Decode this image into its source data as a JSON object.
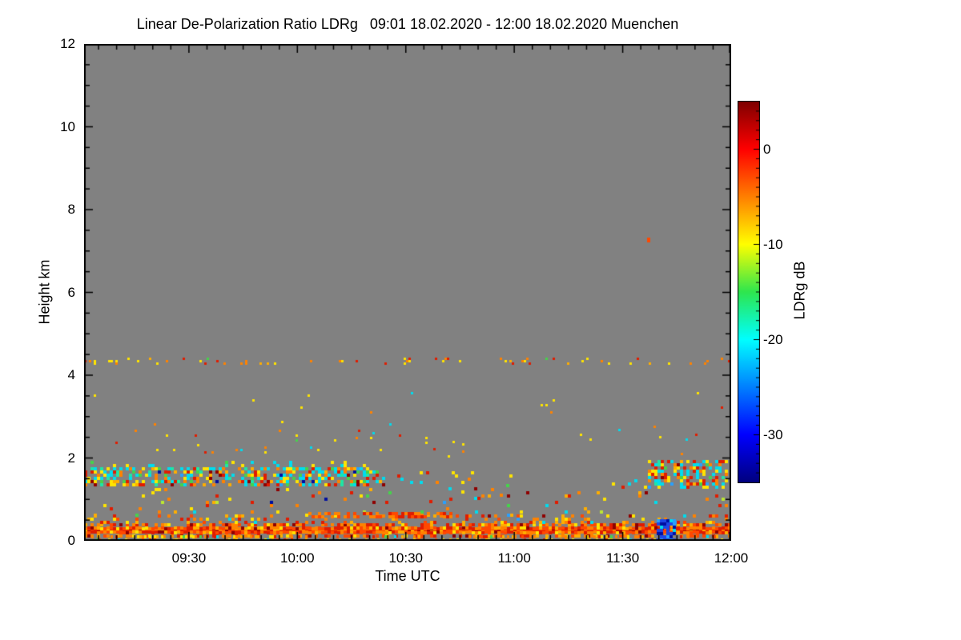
{
  "chart_data": {
    "type": "heatmap",
    "title": "Linear De-Polarization Ratio LDRg   09:01 18.02.2020 - 12:00 18.02.2020 Muenchen",
    "xlabel": "Time UTC",
    "ylabel": "Height km",
    "ylim": [
      0,
      12
    ],
    "x_range_minutes": [
      0,
      179
    ],
    "x_ticks": [
      {
        "label": "09:30",
        "minutes": 29
      },
      {
        "label": "10:00",
        "minutes": 59
      },
      {
        "label": "10:30",
        "minutes": 89
      },
      {
        "label": "11:00",
        "minutes": 119
      },
      {
        "label": "11:30",
        "minutes": 149
      },
      {
        "label": "12:00",
        "minutes": 179
      }
    ],
    "x_minor_step_minutes": 5,
    "y_ticks": [
      {
        "label": "0",
        "value": 0
      },
      {
        "label": "2",
        "value": 2
      },
      {
        "label": "4",
        "value": 4
      },
      {
        "label": "6",
        "value": 6
      },
      {
        "label": "8",
        "value": 8
      },
      {
        "label": "10",
        "value": 10
      },
      {
        "label": "12",
        "value": 12
      }
    ],
    "y_minor_step": 0.5,
    "grid": false,
    "no_data_color": "#818181",
    "frame_color": "#000000",
    "colorbar": {
      "label": "LDRg dB",
      "position": "right",
      "range_top": 5,
      "range_bottom": -35,
      "ticks": [
        {
          "label": "0",
          "value": 0
        },
        {
          "label": "-10",
          "value": -10
        },
        {
          "label": "-20",
          "value": -20
        },
        {
          "label": "-30",
          "value": -30
        }
      ],
      "minor_step": 1,
      "gradient": [
        {
          "pos": 0.0,
          "color": "#7f0000"
        },
        {
          "pos": 0.125,
          "color": "#ff0000"
        },
        {
          "pos": 0.375,
          "color": "#ffff00"
        },
        {
          "pos": 0.5,
          "color": "#2ee64e"
        },
        {
          "pos": 0.625,
          "color": "#00ffff"
        },
        {
          "pos": 0.875,
          "color": "#0000ff"
        },
        {
          "pos": 1.0,
          "color": "#00007f"
        }
      ]
    },
    "palette_colors": {
      "darkred": "#8f0000",
      "red": "#e01c00",
      "orangered": "#ff4800",
      "orange": "#ff8200",
      "amber": "#ffae00",
      "yellow": "#ffe400",
      "yellowgreen": "#bce632",
      "green": "#46d24b",
      "teal": "#1ee6a5",
      "cyan": "#00dcee",
      "lightblue": "#28a0ff",
      "blue": "#1e46e6",
      "darkblue": "#000fa0"
    },
    "render_seed": 1234,
    "features": [
      {
        "name": "surface-core-row",
        "t": [
          0,
          179
        ],
        "h": [
          0.24,
          0.32
        ],
        "density": 1.0,
        "cell": [
          4,
          4
        ],
        "palette": {
          "orangered": 0.28,
          "red": 0.3,
          "orange": 0.2,
          "darkred": 0.12,
          "amber": 0.07,
          "yellow": 0.03
        }
      },
      {
        "name": "surface-row-upper",
        "t": [
          0,
          179
        ],
        "h": [
          0.32,
          0.42
        ],
        "density": 0.72,
        "cell": [
          4,
          4
        ],
        "palette": {
          "orange": 0.3,
          "red": 0.22,
          "orangered": 0.22,
          "amber": 0.12,
          "darkred": 0.07,
          "yellow": 0.07
        }
      },
      {
        "name": "surface-row-lower",
        "t": [
          0,
          179
        ],
        "h": [
          0.14,
          0.24
        ],
        "density": 0.55,
        "cell": [
          4,
          4
        ],
        "palette": {
          "orange": 0.3,
          "orangered": 0.25,
          "red": 0.2,
          "amber": 0.12,
          "yellow": 0.08,
          "darkred": 0.05
        }
      },
      {
        "name": "near-ground-speckle",
        "t": [
          0,
          179
        ],
        "h": [
          0.02,
          0.14
        ],
        "density": 0.3,
        "cell": [
          3,
          4
        ],
        "palette": {
          "orange": 0.28,
          "yellow": 0.22,
          "amber": 0.18,
          "red": 0.12,
          "orangered": 0.1,
          "cyan": 0.05,
          "green": 0.05
        }
      },
      {
        "name": "surface-top-speckle",
        "t": [
          0,
          179
        ],
        "h": [
          0.42,
          0.64
        ],
        "density": 0.22,
        "cell": [
          4,
          4
        ],
        "palette": {
          "orange": 0.26,
          "red": 0.2,
          "amber": 0.18,
          "yellow": 0.14,
          "orangered": 0.1,
          "darkred": 0.05,
          "cyan": 0.04,
          "lightblue": 0.03
        }
      },
      {
        "name": "boundary-layer-speckle",
        "t": [
          0,
          179
        ],
        "h": [
          0.64,
          1.28
        ],
        "density": 0.055,
        "cell": [
          4,
          4
        ],
        "palette": {
          "yellow": 0.24,
          "orange": 0.2,
          "red": 0.17,
          "amber": 0.12,
          "cyan": 0.09,
          "green": 0.07,
          "darkred": 0.05,
          "yellowgreen": 0.03,
          "lightblue": 0.02,
          "darkblue": 0.01
        }
      },
      {
        "name": "mid-dashed-line",
        "t": [
          62,
          101
        ],
        "h": [
          0.6,
          0.7
        ],
        "density": 0.6,
        "cell": [
          4,
          4
        ],
        "palette": {
          "orange": 0.45,
          "orangered": 0.3,
          "red": 0.15,
          "darkred": 0.05,
          "amber": 0.05
        }
      },
      {
        "name": "morning-aerosol-layer",
        "t": [
          0,
          78
        ],
        "h": [
          1.32,
          1.78
        ],
        "density": 0.5,
        "cell": [
          4,
          4
        ],
        "palette": {
          "cyan": 0.24,
          "yellow": 0.2,
          "orange": 0.13,
          "red": 0.13,
          "green": 0.08,
          "teal": 0.06,
          "amber": 0.06,
          "darkred": 0.04,
          "lightblue": 0.04,
          "darkblue": 0.02
        }
      },
      {
        "name": "morning-layer-top",
        "t": [
          0,
          78
        ],
        "h": [
          1.78,
          1.94
        ],
        "density": 0.12,
        "cell": [
          4,
          4
        ],
        "palette": {
          "cyan": 0.35,
          "yellow": 0.3,
          "green": 0.15,
          "teal": 0.1,
          "orange": 0.1
        }
      },
      {
        "name": "morning-layer-tail",
        "t": [
          78,
          84
        ],
        "h": [
          1.35,
          1.7
        ],
        "density": 0.25,
        "cell": [
          4,
          4
        ],
        "palette": {
          "cyan": 0.24,
          "yellow": 0.2,
          "orange": 0.13,
          "red": 0.13,
          "green": 0.08,
          "teal": 0.06,
          "amber": 0.06,
          "darkred": 0.04,
          "lightblue": 0.04,
          "darkblue": 0.02
        }
      },
      {
        "name": "midday-patches",
        "t": [
          84,
          118
        ],
        "h": [
          0.95,
          1.68
        ],
        "density": 0.06,
        "cell": [
          4,
          4
        ],
        "palette": {
          "yellow": 0.28,
          "cyan": 0.18,
          "orange": 0.18,
          "red": 0.14,
          "green": 0.12,
          "amber": 0.05,
          "darkred": 0.05
        }
      },
      {
        "name": "pre-evening-speckle",
        "t": [
          145,
          156
        ],
        "h": [
          1.3,
          1.65
        ],
        "density": 0.09,
        "cell": [
          4,
          4
        ],
        "palette": {
          "yellow": 0.4,
          "orange": 0.25,
          "cyan": 0.2,
          "red": 0.15
        }
      },
      {
        "name": "evening-aerosol-layer",
        "t": [
          156,
          178
        ],
        "h": [
          1.3,
          1.95
        ],
        "density": 0.45,
        "cell": [
          4,
          4
        ],
        "palette": {
          "cyan": 0.22,
          "yellow": 0.22,
          "red": 0.15,
          "orange": 0.14,
          "green": 0.08,
          "amber": 0.06,
          "teal": 0.05,
          "darkred": 0.04,
          "lightblue": 0.04
        }
      },
      {
        "name": "thin-layer-4.35km",
        "t": [
          0,
          179
        ],
        "h": [
          4.28,
          4.43
        ],
        "density": 0.08,
        "cell": [
          3,
          3
        ],
        "palette": {
          "yellow": 0.5,
          "orange": 0.22,
          "red": 0.14,
          "amber": 0.09,
          "green": 0.05
        }
      },
      {
        "name": "sparse-dots-2.5km-morning",
        "t": [
          4,
          96
        ],
        "h": [
          2.15,
          2.68
        ],
        "density": 0.02,
        "cell": [
          3,
          3
        ],
        "palette": {
          "yellow": 0.5,
          "orange": 0.2,
          "red": 0.15,
          "cyan": 0.1,
          "green": 0.05
        }
      },
      {
        "name": "sparse-dots-2.5km-afternoon",
        "t": [
          96,
          179
        ],
        "h": [
          2.0,
          2.7
        ],
        "density": 0.011,
        "cell": [
          3,
          3
        ],
        "palette": {
          "yellow": 0.45,
          "orange": 0.2,
          "red": 0.15,
          "cyan": 0.12,
          "green": 0.08
        }
      },
      {
        "name": "very-sparse-3km",
        "t": [
          0,
          179
        ],
        "h": [
          2.7,
          3.6
        ],
        "density": 0.004,
        "cell": [
          3,
          3
        ],
        "palette": {
          "yellow": 0.4,
          "orange": 0.3,
          "cyan": 0.15,
          "red": 0.15
        }
      },
      {
        "name": "drizzle-blue-patch",
        "t": [
          158.5,
          163.5
        ],
        "h": [
          0.05,
          0.52
        ],
        "density": 0.8,
        "cell": [
          4,
          4
        ],
        "palette": {
          "blue": 0.42,
          "darkblue": 0.3,
          "lightblue": 0.16,
          "cyan": 0.12
        }
      }
    ],
    "points": [
      {
        "name": "isolated-cloud-pixel",
        "t": 155.7,
        "h": 7.33,
        "color": "orangered",
        "w": 4,
        "hp": 6
      }
    ]
  }
}
